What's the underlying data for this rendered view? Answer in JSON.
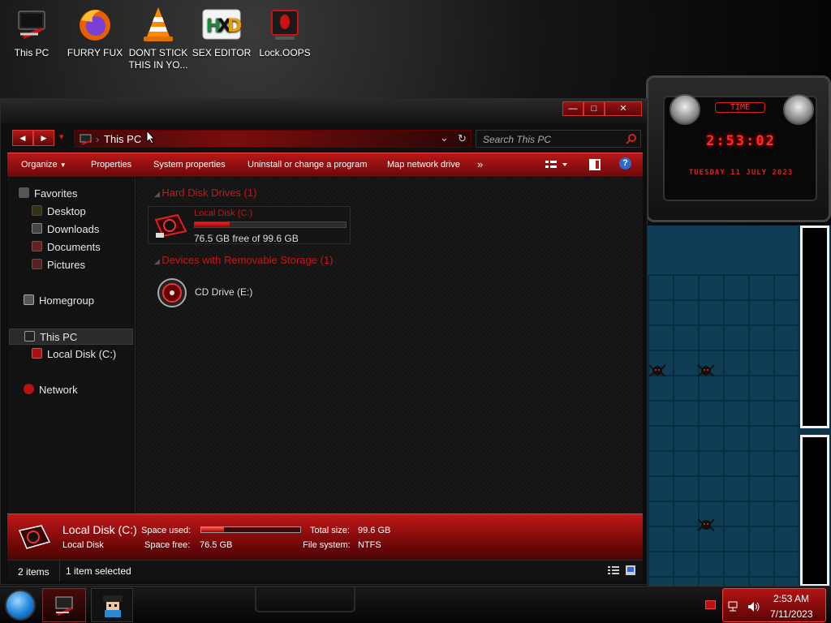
{
  "desktop": {
    "icons": [
      {
        "label": "This PC",
        "icon": "this-pc-icon"
      },
      {
        "label": "FURRY FUX",
        "icon": "firefox-icon"
      },
      {
        "label": "DONT STICK THIS IN YO...",
        "icon": "vlc-cone-icon"
      },
      {
        "label": "SEX EDITOR",
        "icon": "hex-editor-icon"
      },
      {
        "label": "Lock.OOPS",
        "icon": "lock-alienware-icon"
      }
    ]
  },
  "widget": {
    "label": "TIME",
    "time": "2:53:02",
    "date": "TUESDAY 11 JULY 2023"
  },
  "window": {
    "controls": {
      "minimize": "—",
      "maximize": "□",
      "close": "✕"
    },
    "nav": {
      "back": "◀",
      "forward": "▶",
      "recent": "▾"
    },
    "address": "This PC",
    "address_dropdown": "⌄",
    "refresh": "↻",
    "search_placeholder": "Search This PC",
    "toolbar": {
      "organize": "Organize",
      "properties": "Properties",
      "system_properties": "System properties",
      "uninstall": "Uninstall or change a program",
      "map_drive": "Map network drive",
      "more": "»",
      "help": "?"
    },
    "sidebar": {
      "favorites": "Favorites",
      "desktop": "Desktop",
      "downloads": "Downloads",
      "documents": "Documents",
      "pictures": "Pictures",
      "homegroup": "Homegroup",
      "this_pc": "This PC",
      "local_disk": "Local Disk (C:)",
      "network": "Network"
    },
    "content": {
      "group_hdd": "Hard Disk Drives (1)",
      "drive_c_name": "Local Disk (C:)",
      "drive_c_free": "76.5 GB free of 99.6 GB",
      "drive_c_used_fraction": 0.232,
      "group_removable": "Devices with Removable Storage (1)",
      "cd_drive_name": "CD Drive (E:)"
    },
    "details": {
      "name": "Local Disk (C:)",
      "type": "Local Disk",
      "space_used_label": "Space used:",
      "space_free_label": "Space free:",
      "space_free_value": "76.5 GB",
      "total_size_label": "Total size:",
      "total_size_value": "99.6 GB",
      "file_system_label": "File system:",
      "file_system_value": "NTFS",
      "used_fraction": 0.232
    },
    "status": {
      "items": "2 items",
      "selected": "1 item selected"
    }
  },
  "taskbar": {
    "time": "2:53 AM",
    "date": "7/11/2023"
  },
  "colors": {
    "accent": "#b81818",
    "accent_dark": "#5e0707",
    "group_text": "#c81616"
  }
}
